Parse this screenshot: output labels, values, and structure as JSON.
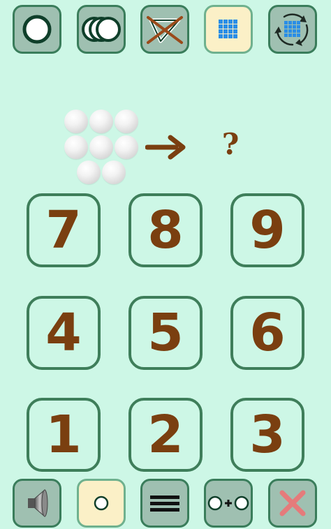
{
  "top_toolbar": [
    {
      "name": "single-mode-button",
      "icon": "circle-icon"
    },
    {
      "name": "multi-mode-button",
      "icon": "triple-circle-icon"
    },
    {
      "name": "disabled-mode-button",
      "icon": "crossed-triangle-icon"
    },
    {
      "name": "grid-mode-button",
      "icon": "grid-icon"
    },
    {
      "name": "shuffle-grid-button",
      "icon": "recycle-grid-icon"
    }
  ],
  "puzzle": {
    "ball_count": 8,
    "arrow": "➜",
    "question": "?"
  },
  "keypad": {
    "rows": [
      [
        "7",
        "8",
        "9"
      ],
      [
        "4",
        "5",
        "6"
      ],
      [
        "1",
        "2",
        "3"
      ]
    ]
  },
  "bottom_toolbar": [
    {
      "name": "sound-button",
      "icon": "speaker-icon"
    },
    {
      "name": "dot-mode-button",
      "icon": "small-circle-icon"
    },
    {
      "name": "menu-button",
      "icon": "hamburger-icon"
    },
    {
      "name": "addition-button",
      "icon": "circle-plus-circle-icon"
    },
    {
      "name": "close-button",
      "icon": "close-icon"
    }
  ],
  "colors": {
    "background": "#cdf7e6",
    "button_border": "#3e7e5a",
    "digit": "#7a3f10",
    "button_fill": "#9fc0b1",
    "cream": "#fbf0c7"
  }
}
